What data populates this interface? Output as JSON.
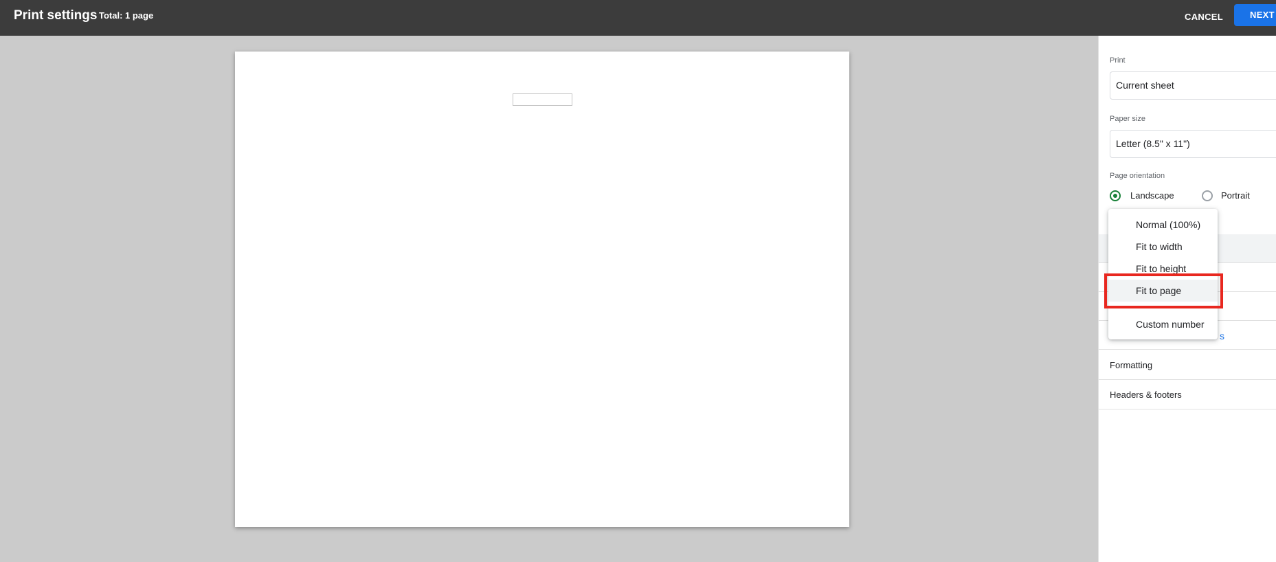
{
  "header": {
    "title": "Print settings",
    "total": "Total: 1 page",
    "cancel_label": "CANCEL",
    "next_label": "NEXT"
  },
  "panel": {
    "print_label": "Print",
    "print_value": "Current sheet",
    "paper_size_label": "Paper size",
    "paper_size_value": "Letter (8.5\" x 11\")",
    "orientation_label": "Page orientation",
    "orientation_options": [
      {
        "label": "Landscape",
        "selected": true
      },
      {
        "label": "Portrait",
        "selected": false
      }
    ],
    "link_fragment": "s",
    "sections": [
      "Formatting",
      "Headers & footers"
    ]
  },
  "scale_menu": {
    "items": [
      "Normal (100%)",
      "Fit to width",
      "Fit to height",
      "Fit to page",
      "Custom number"
    ],
    "highlighted": "Fit to page"
  },
  "colors": {
    "topbar": "#3c3c3c",
    "accent": "#1a73e8",
    "radio_checked": "#188038",
    "annotation": "#e8271f"
  }
}
